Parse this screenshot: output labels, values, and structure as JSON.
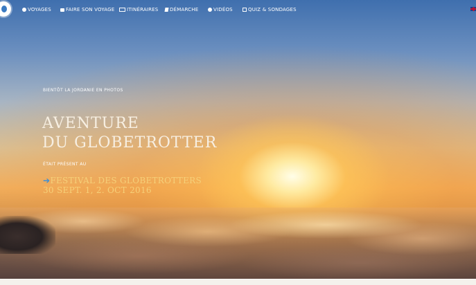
{
  "nav": {
    "items": [
      {
        "label": "VOYAGES",
        "icon": "globe-icon"
      },
      {
        "label": "FAIRE SON VOYAGE",
        "icon": "suitcase-icon"
      },
      {
        "label": "ITINÉRAIRES",
        "icon": "map-icon"
      },
      {
        "label": "DÉMARCHE",
        "icon": "book-icon"
      },
      {
        "label": "VIDÉOS",
        "icon": "play-icon"
      },
      {
        "label": "QUIZ & SONDAGES",
        "icon": "checkbox-icon"
      }
    ],
    "language_flag": "uk-flag-icon"
  },
  "hero": {
    "caption": "BIENTÔT LA JORDANIE EN PHOTOS",
    "title_line1": "AVENTURE",
    "title_line2": "DU GLOBETROTTER",
    "present_label": "ÉTAIT PRÉSENT AU",
    "festival_arrow": "➔",
    "festival_name": "FESTIVAL DES GLOBETROTTERS",
    "festival_dates": "30 SEPT. 1, 2. OCT 2016"
  },
  "colors": {
    "festival_text": "#f6d079",
    "arrow": "#3f8fd4",
    "title_text": "#f7efe2"
  }
}
